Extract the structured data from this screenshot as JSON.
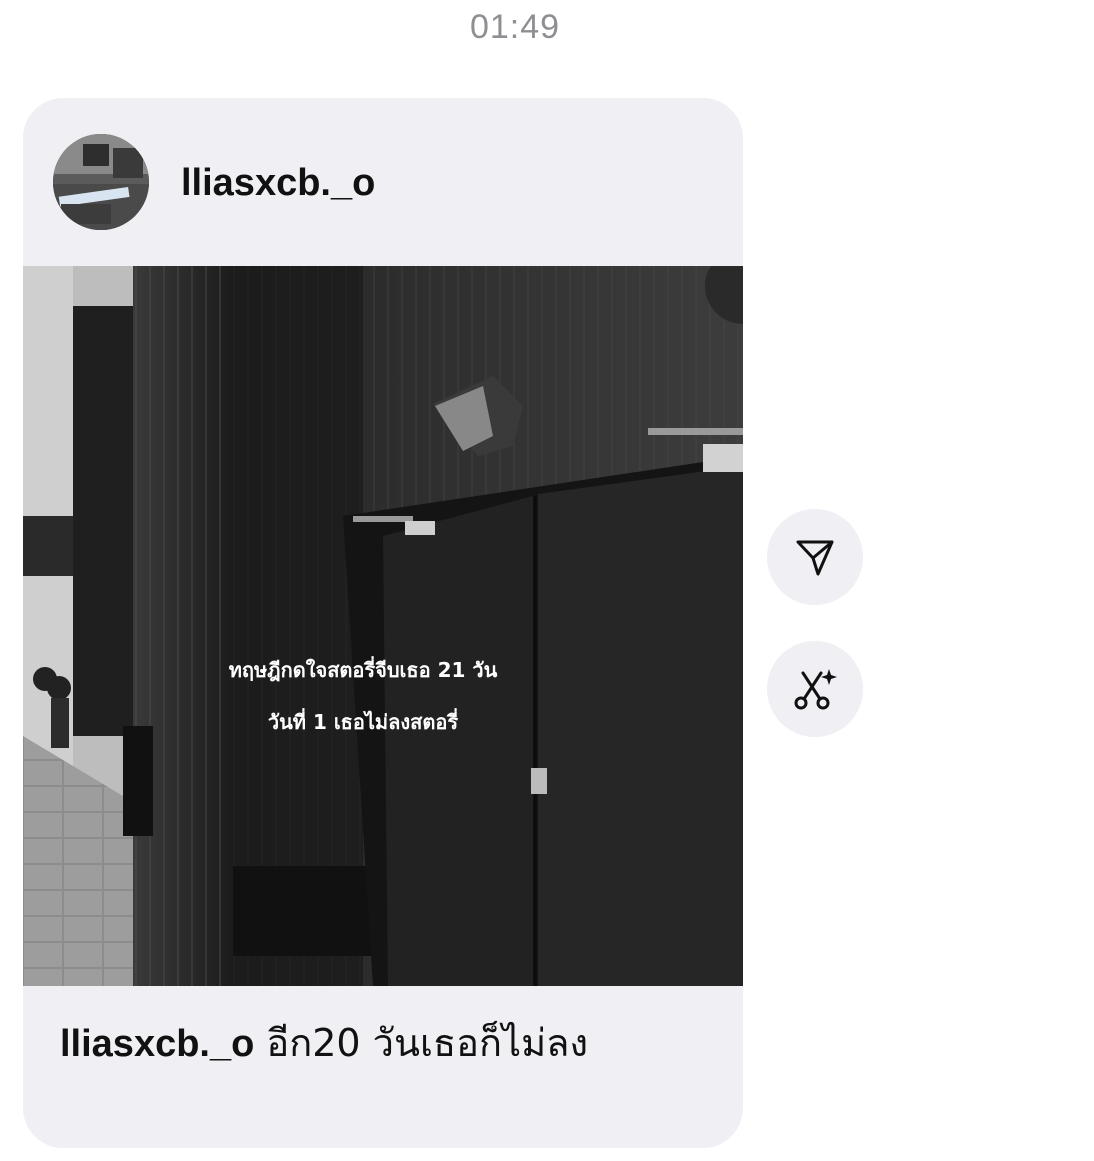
{
  "timestamp": "01:49",
  "post": {
    "username": "lliasxcb._o",
    "overlay_line1": "ทฤษฎีกดใจสตอรี่จีบเธอ 21 วัน",
    "overlay_line2": "วันที่ 1 เธอไม่ลงสตอรี่",
    "caption_user": "lliasxcb._o",
    "caption_text": "อีก20 วันเธอก็ไม่ลง"
  },
  "actions": {
    "share_icon": "send-icon",
    "ai_icon": "scissors-sparkle-icon"
  }
}
